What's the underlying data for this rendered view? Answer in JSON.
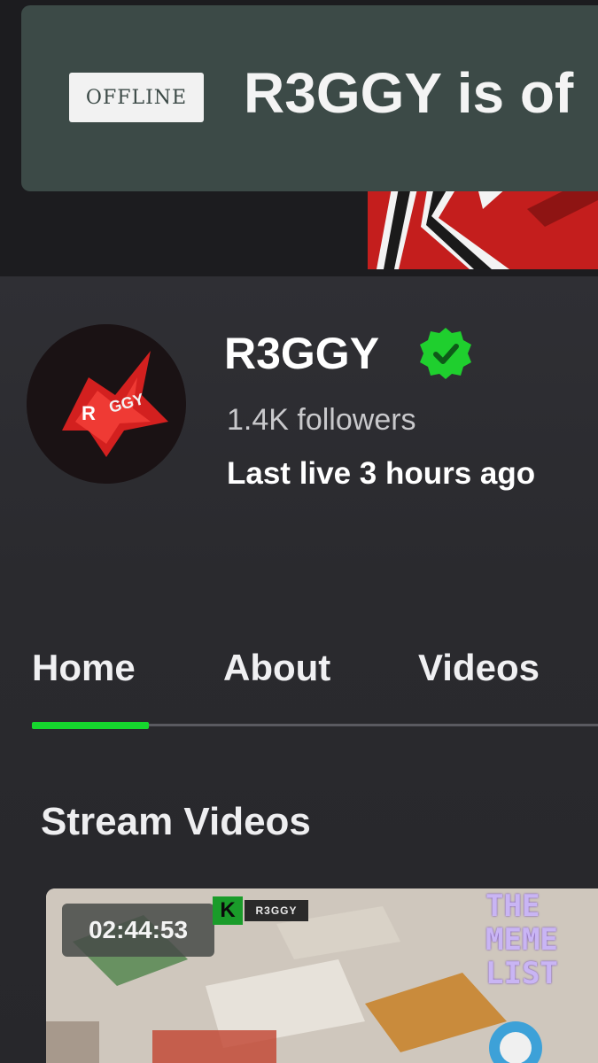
{
  "offline_banner": {
    "badge": "OFFLINE",
    "title": "R3GGY is of"
  },
  "channel": {
    "name": "R3GGY",
    "followers": "1.4K followers",
    "last_live": "Last live 3 hours ago",
    "verified_icon": "verified-badge-icon",
    "accent_color": "#16d62e"
  },
  "tabs": [
    {
      "label": "Home",
      "active": true
    },
    {
      "label": "About",
      "active": false
    },
    {
      "label": "Videos",
      "active": false
    }
  ],
  "section": {
    "title": "Stream Videos"
  },
  "video": {
    "duration": "02:44:53",
    "channel_tag": "R3GGY",
    "logo_letter": "K",
    "thumb_text_lines": [
      "THE",
      "MEME",
      "LIST"
    ]
  }
}
